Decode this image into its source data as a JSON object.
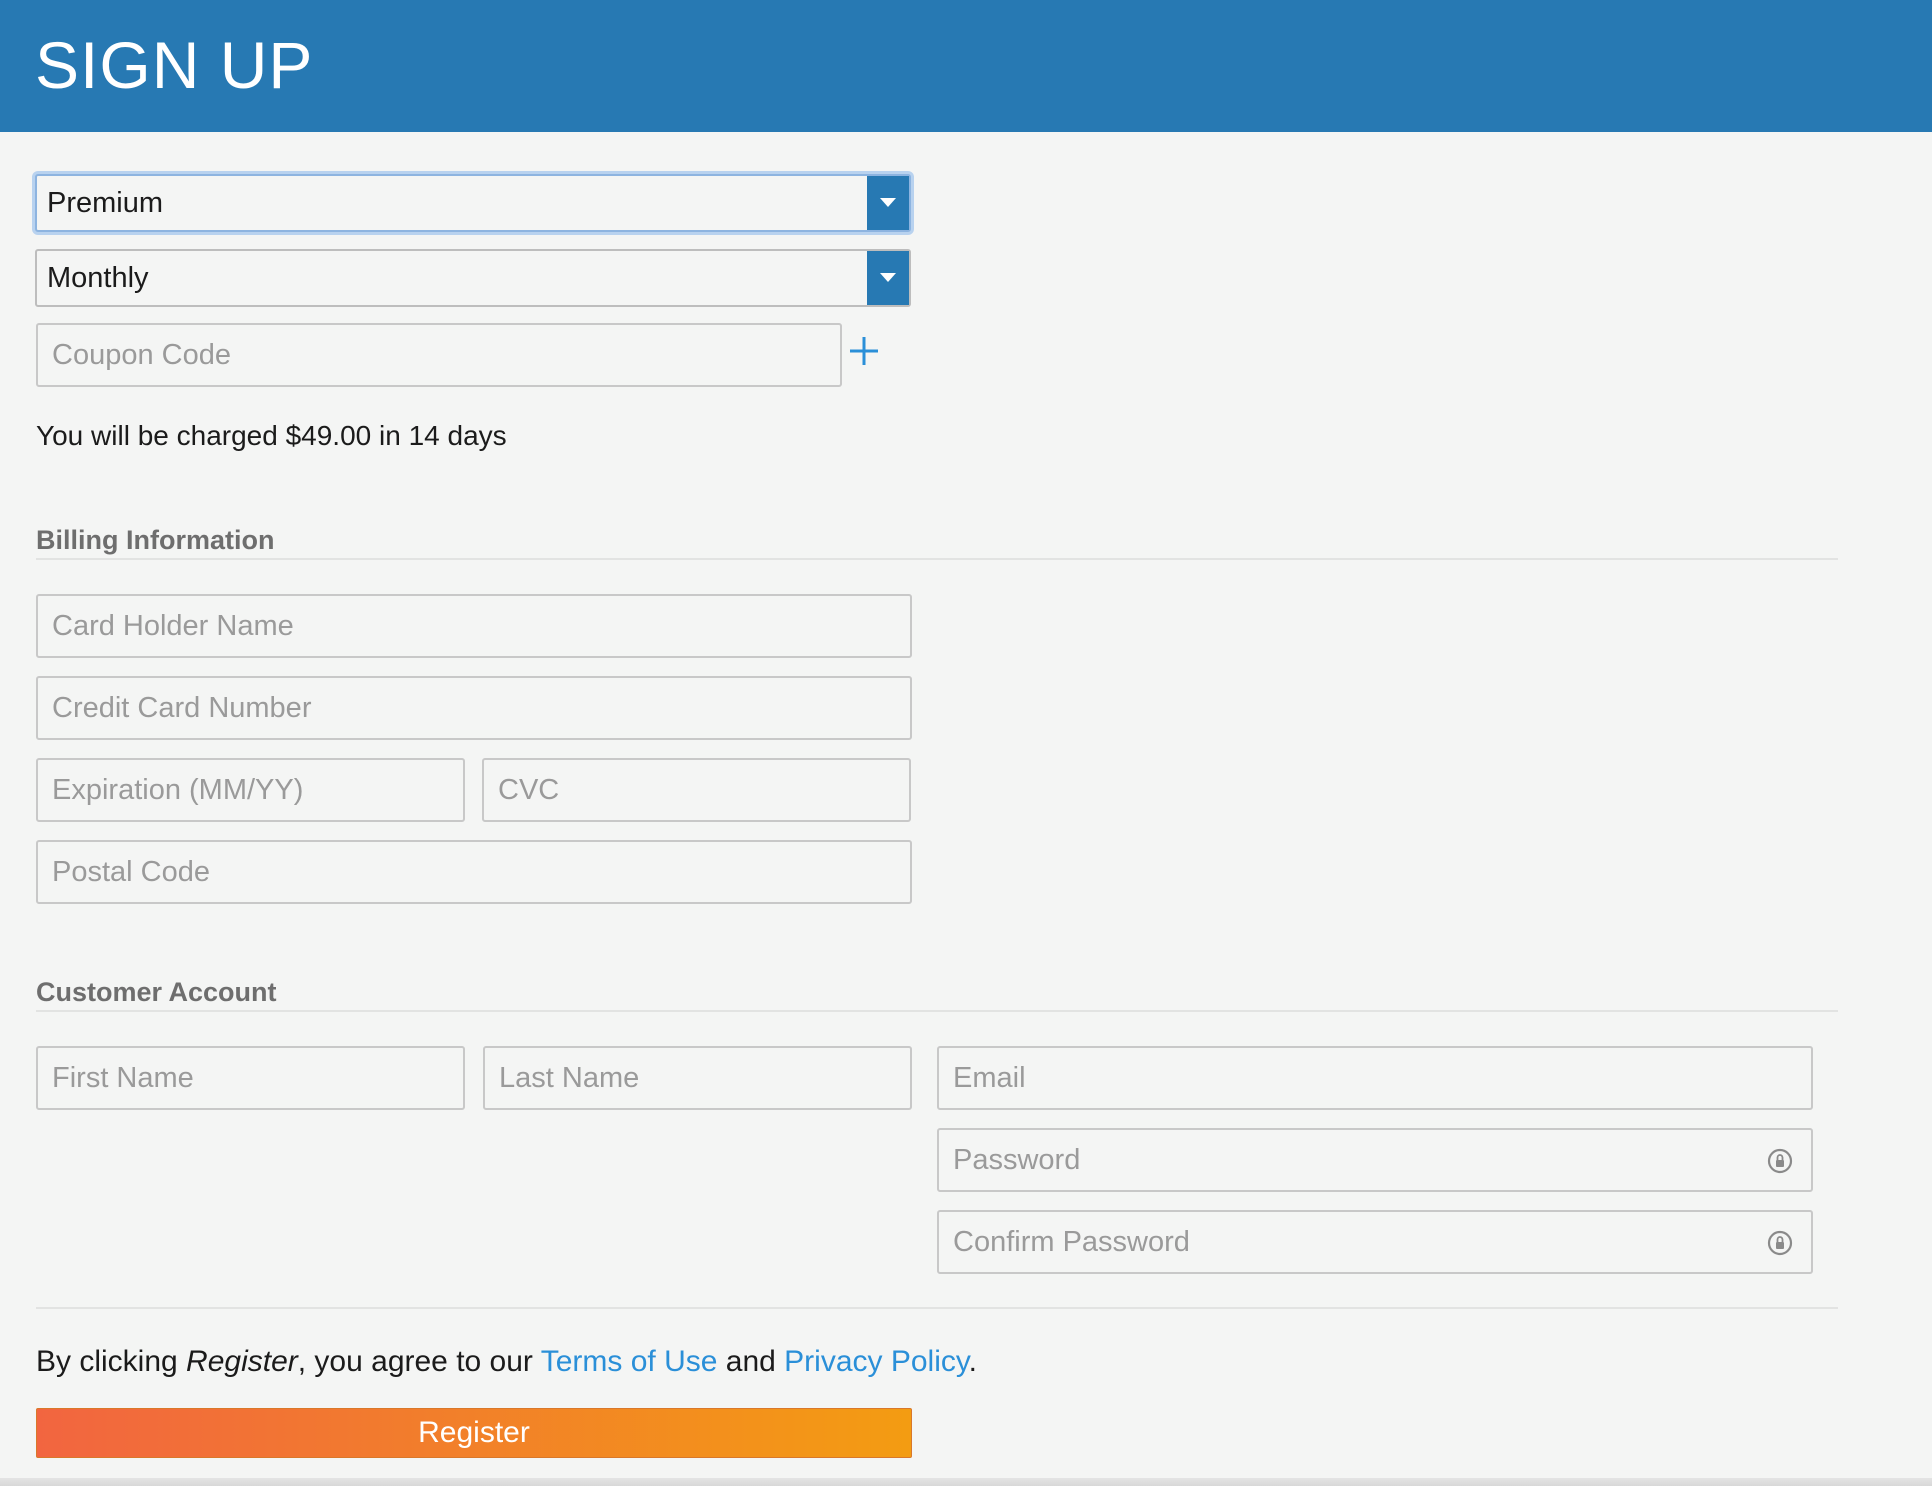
{
  "header": {
    "title": "SIGN UP",
    "background": "#2779b3"
  },
  "plan": {
    "plan_select_value": "Premium",
    "period_select_value": "Monthly",
    "coupon_placeholder": "Coupon Code",
    "add_coupon_icon": "plus-icon"
  },
  "charge_notice": "You will be charged $49.00 in 14 days",
  "billing": {
    "section_title": "Billing Information",
    "card_holder_placeholder": "Card Holder Name",
    "card_number_placeholder": "Credit Card Number",
    "expiration_placeholder": "Expiration (MM/YY)",
    "cvc_placeholder": "CVC",
    "postal_placeholder": "Postal Code"
  },
  "account": {
    "section_title": "Customer Account",
    "first_name_placeholder": "First Name",
    "last_name_placeholder": "Last Name",
    "email_placeholder": "Email",
    "password_placeholder": "Password",
    "confirm_password_placeholder": "Confirm Password",
    "password_icon": "lock-icon"
  },
  "legal": {
    "prefix": "By clicking ",
    "action_word": "Register",
    "middle": ", you agree to our ",
    "terms_link": "Terms of Use",
    "conjunction": " and ",
    "privacy_link": "Privacy Policy",
    "suffix": "."
  },
  "register_button": {
    "label": "Register",
    "gradient_start": "#f26540",
    "gradient_end": "#f39c12"
  },
  "colors": {
    "link": "#2a8fd8",
    "page_background": "#f4f5f4",
    "section_title": "#6e6e6e"
  }
}
